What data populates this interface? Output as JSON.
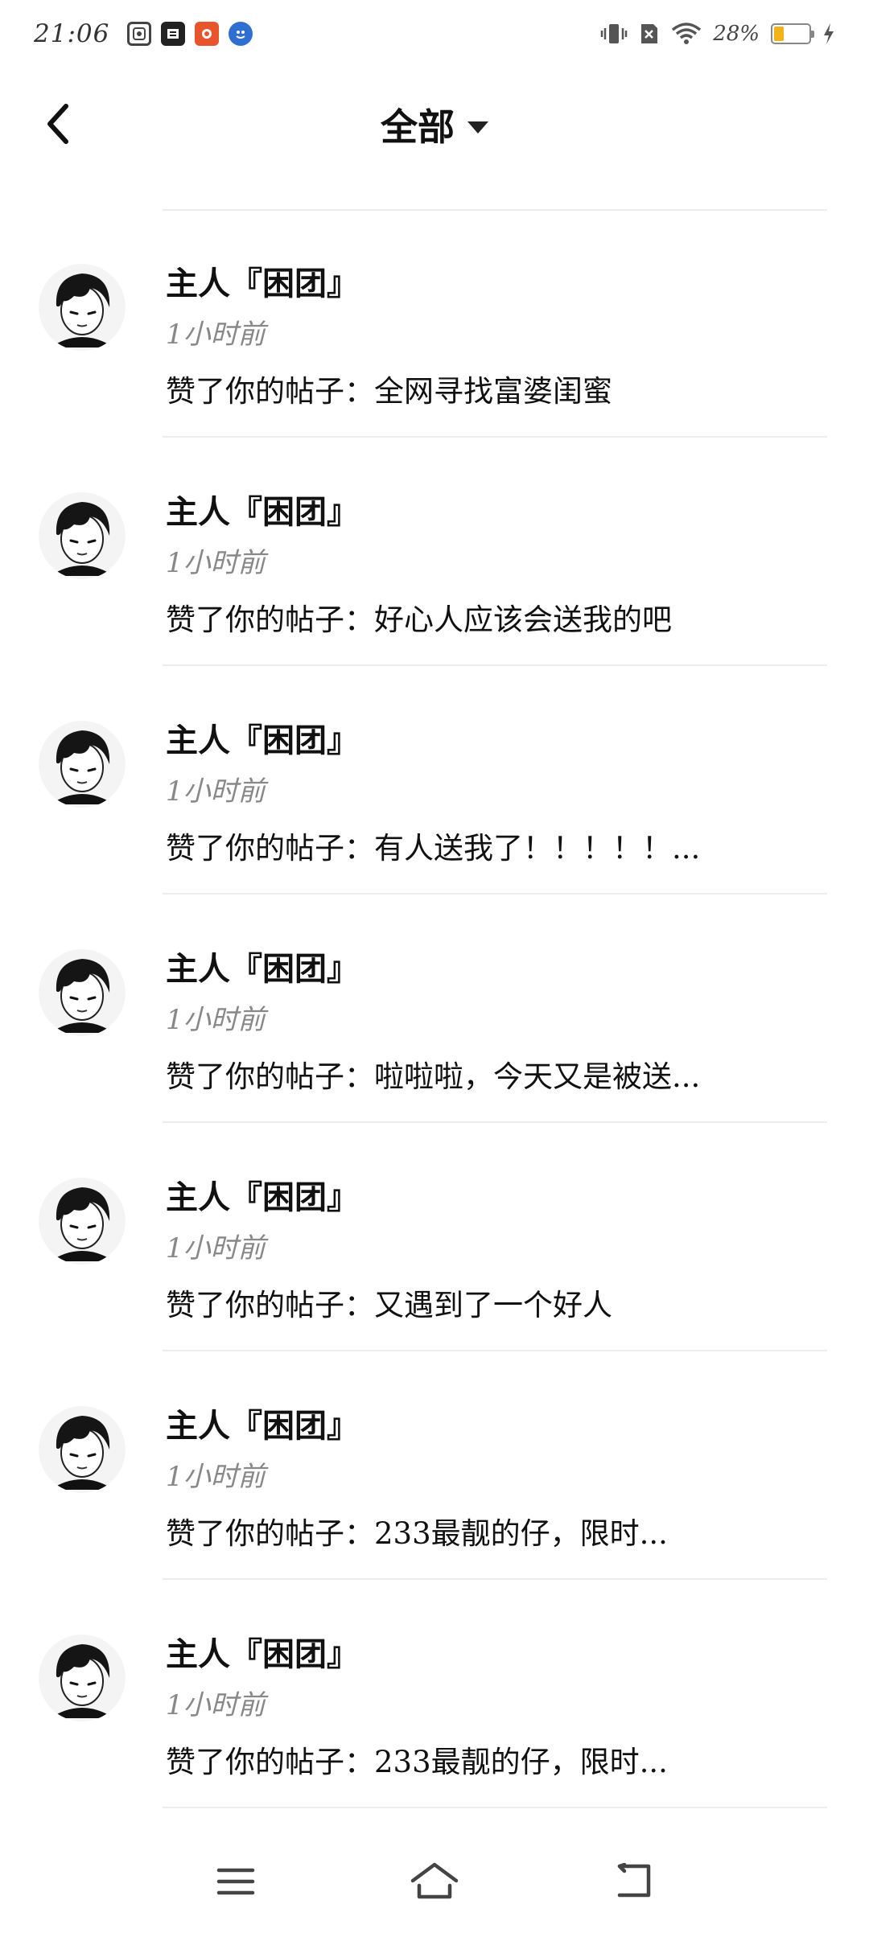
{
  "status_bar": {
    "time": "21:06",
    "battery_text": "28%",
    "battery_level": 0.28,
    "apps": [
      "app-icon-1",
      "app-icon-2",
      "app-icon-3",
      "app-icon-4"
    ]
  },
  "header": {
    "title": "全部"
  },
  "notifications": [
    {
      "name": "主人『困团』",
      "time": "1小时前",
      "prefix": "赞了你的帖子：",
      "post": "全网寻找富婆闺蜜"
    },
    {
      "name": "主人『困团』",
      "time": "1小时前",
      "prefix": "赞了你的帖子：",
      "post": "好心人应该会送我的吧"
    },
    {
      "name": "主人『困团』",
      "time": "1小时前",
      "prefix": "赞了你的帖子：",
      "post": "有人送我了！！！！！..."
    },
    {
      "name": "主人『困团』",
      "time": "1小时前",
      "prefix": "赞了你的帖子：",
      "post": "啦啦啦，今天又是被送..."
    },
    {
      "name": "主人『困团』",
      "time": "1小时前",
      "prefix": "赞了你的帖子：",
      "post": "又遇到了一个好人"
    },
    {
      "name": "主人『困团』",
      "time": "1小时前",
      "prefix": "赞了你的帖子：",
      "post": "233最靓的仔，限时..."
    },
    {
      "name": "主人『困团』",
      "time": "1小时前",
      "prefix": "赞了你的帖子：",
      "post": "233最靓的仔，限时..."
    }
  ],
  "nav": {
    "icons": [
      "menu-icon",
      "home-icon",
      "back-nav-icon"
    ]
  },
  "colors": {
    "text": "#111111",
    "muted": "#888888",
    "divider": "#ededed",
    "battery": "#f3b21b"
  }
}
